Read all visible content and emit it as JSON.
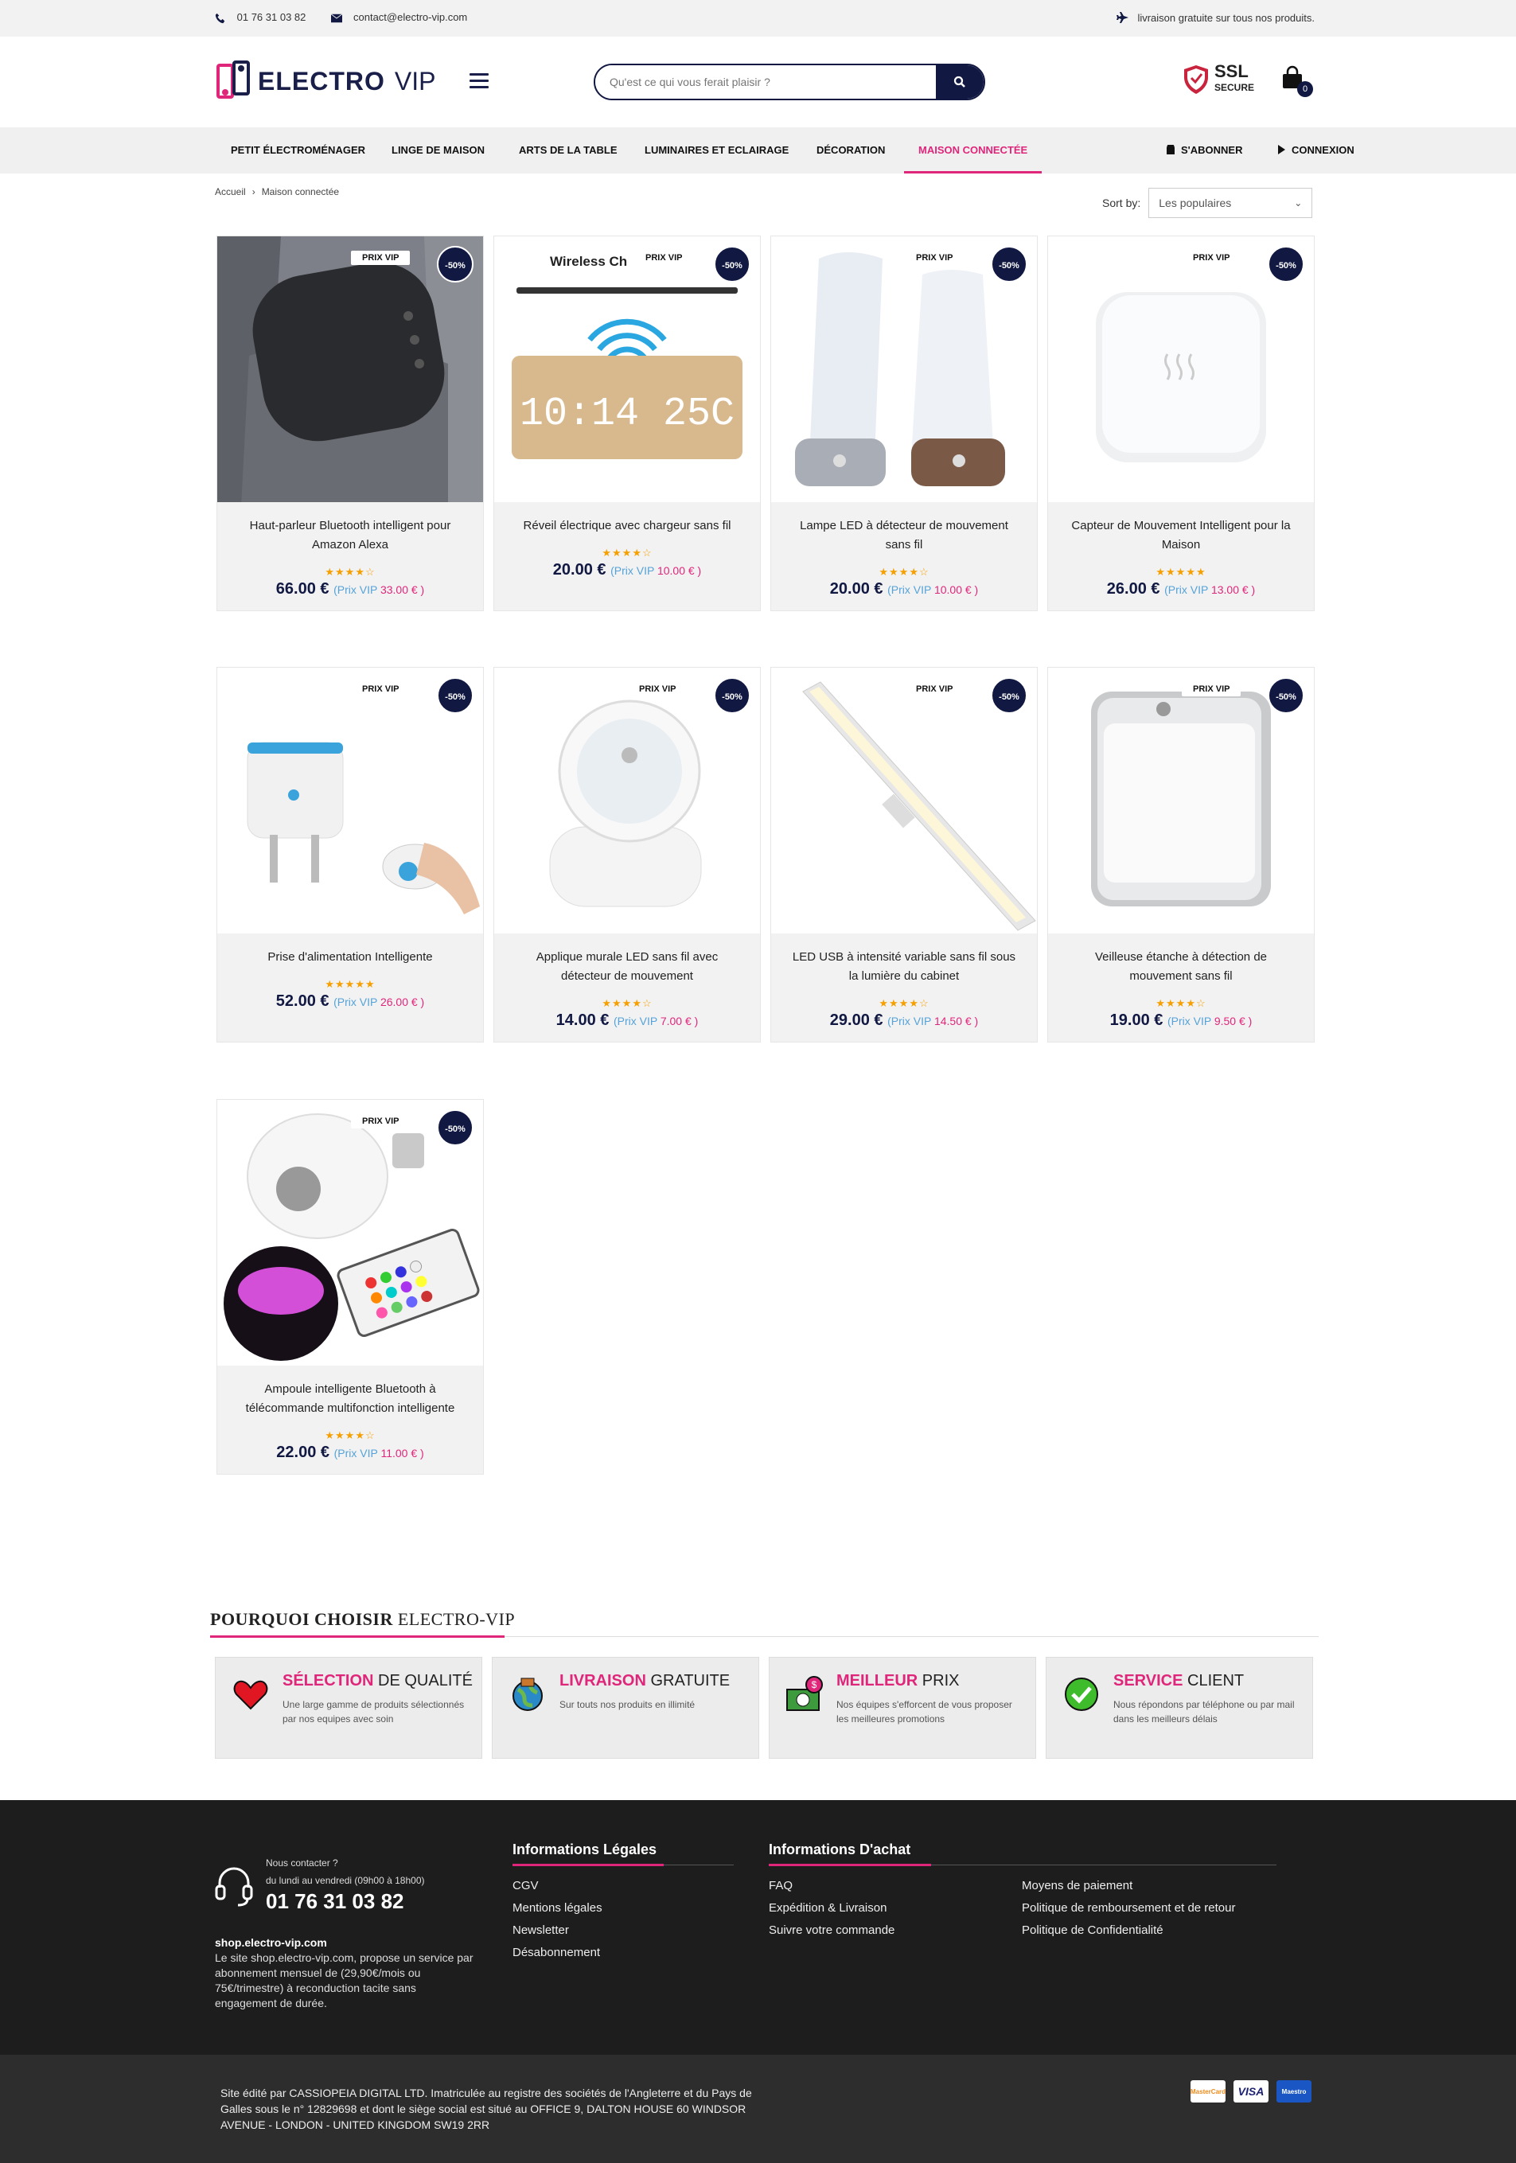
{
  "topbar": {
    "phone": "01 76 31 03 82",
    "email": "contact@electro-vip.com",
    "shipping_note": "livraison gratuite sur tous nos produits."
  },
  "header": {
    "logo_part1": "ELECTRO",
    "logo_part2": "VIP",
    "search_placeholder": "Qu'est ce qui vous ferait plaisir ?",
    "ssl_title": "SSL",
    "ssl_sub": "SECURE",
    "cart_count": "0"
  },
  "nav": {
    "items": [
      "Petit électroménager",
      "Linge de maison",
      "Arts de la table",
      "Luminaires et eclairage",
      "Décoration",
      "Maison connectée"
    ],
    "subscribe": "S'abonner",
    "login": "Connexion"
  },
  "breadcrumb": {
    "home": "Accueil",
    "current": "Maison connectée"
  },
  "sort": {
    "label": "Sort by:",
    "selected": "Les populaires"
  },
  "product_badge": "PRIX VIP",
  "product_discount": "-50%",
  "products": [
    {
      "name": "Haut-parleur Bluetooth intelligent pour Amazon Alexa",
      "stars": "★★★★☆",
      "price": "66.00 €",
      "vip_label": "(Prix VIP",
      "vip_price": "33.00 € )"
    },
    {
      "name": "Réveil électrique avec chargeur sans fil",
      "stars": "★★★★☆",
      "price": "20.00 €",
      "vip_label": "(Prix VIP",
      "vip_price": "10.00 € )"
    },
    {
      "name": "Lampe LED à détecteur de mouvement sans fil",
      "stars": "★★★★☆",
      "price": "20.00 €",
      "vip_label": "(Prix VIP",
      "vip_price": "10.00 € )"
    },
    {
      "name": "Capteur de Mouvement Intelligent pour la Maison",
      "stars": "★★★★★",
      "price": "26.00 €",
      "vip_label": "(Prix VIP",
      "vip_price": "13.00 € )"
    },
    {
      "name": "Prise d'alimentation Intelligente",
      "stars": "★★★★★",
      "price": "52.00 €",
      "vip_label": "(Prix VIP",
      "vip_price": "26.00 € )"
    },
    {
      "name": "Applique murale LED sans fil avec détecteur de mouvement",
      "stars": "★★★★☆",
      "price": "14.00 €",
      "vip_label": "(Prix VIP",
      "vip_price": "7.00 € )"
    },
    {
      "name": "LED USB à intensité variable sans fil sous la lumière du cabinet",
      "stars": "★★★★☆",
      "price": "29.00 €",
      "vip_label": "(Prix VIP",
      "vip_price": "14.50 € )"
    },
    {
      "name": "Veilleuse étanche à détection de mouvement sans fil",
      "stars": "★★★★☆",
      "price": "19.00 €",
      "vip_label": "(Prix VIP",
      "vip_price": "9.50 € )"
    },
    {
      "name": "Ampoule intelligente Bluetooth à télécommande multifonction intelligente",
      "stars": "★★★★☆",
      "price": "22.00 €",
      "vip_label": "(Prix VIP",
      "vip_price": "11.00 € )"
    }
  ],
  "product2_overlay_text": "Wireless Ch",
  "product2_clock_text": "10:14 25C",
  "why": {
    "title_bold": "POURQUOI CHOISIR",
    "title_rest": "ELECTRO-VIP",
    "items": [
      {
        "h_bold": "Sélection",
        "h_rest": "de qualité",
        "desc": "Une large gamme de produits sélectionnés par nos equipes avec soin"
      },
      {
        "h_bold": "Livraison",
        "h_rest": "gratuite",
        "desc": "Sur touts nos produits en illimité"
      },
      {
        "h_bold": "Meilleur",
        "h_rest": "prix",
        "desc": "Nos équipes s'efforcent de vous proposer les meilleures promotions"
      },
      {
        "h_bold": "Service",
        "h_rest": "client",
        "desc": "Nous répondons par téléphone ou par mail dans les meilleurs délais"
      }
    ]
  },
  "footer": {
    "contact_title": "Nous contacter ?",
    "contact_hours": "du lundi au vendredi (09h00 à 18h00)",
    "phone": "01 76 31 03 82",
    "site": "shop.electro-vip.com",
    "about": "Le site shop.electro-vip.com, propose un service par abonnement mensuel de (29,90€/mois ou 75€/trimestre) à reconduction tacite sans engagement de durée.",
    "legal_title": "Informations Légales",
    "legal_links": [
      "CGV",
      "Mentions légales",
      "Newsletter",
      "Désabonnement"
    ],
    "purchase_title": "Informations D'achat",
    "purchase_links_a": [
      "FAQ",
      "Expédition & Livraison",
      "Suivre votre commande"
    ],
    "purchase_links_b": [
      "Moyens de paiement",
      "Politique de remboursement et de retour",
      "Politique de Confidentialité"
    ],
    "bottom_text": "Site édité par CASSIOPEIA DIGITAL LTD. Imatriculée au registre des sociétés de l'Angleterre et du Pays de Galles sous le n° 12829698 et dont le siège social est situé au OFFICE 9, DALTON HOUSE 60 WINDSOR AVENUE - LONDON - UNITED KINGDOM SW19 2RR",
    "payments": [
      "MasterCard",
      "VISA",
      "Maestro"
    ]
  },
  "colors": {
    "brand_navy": "#111842",
    "brand_pink": "#e0267a",
    "star": "#f5a000",
    "vip_blue": "#55a3d8"
  }
}
